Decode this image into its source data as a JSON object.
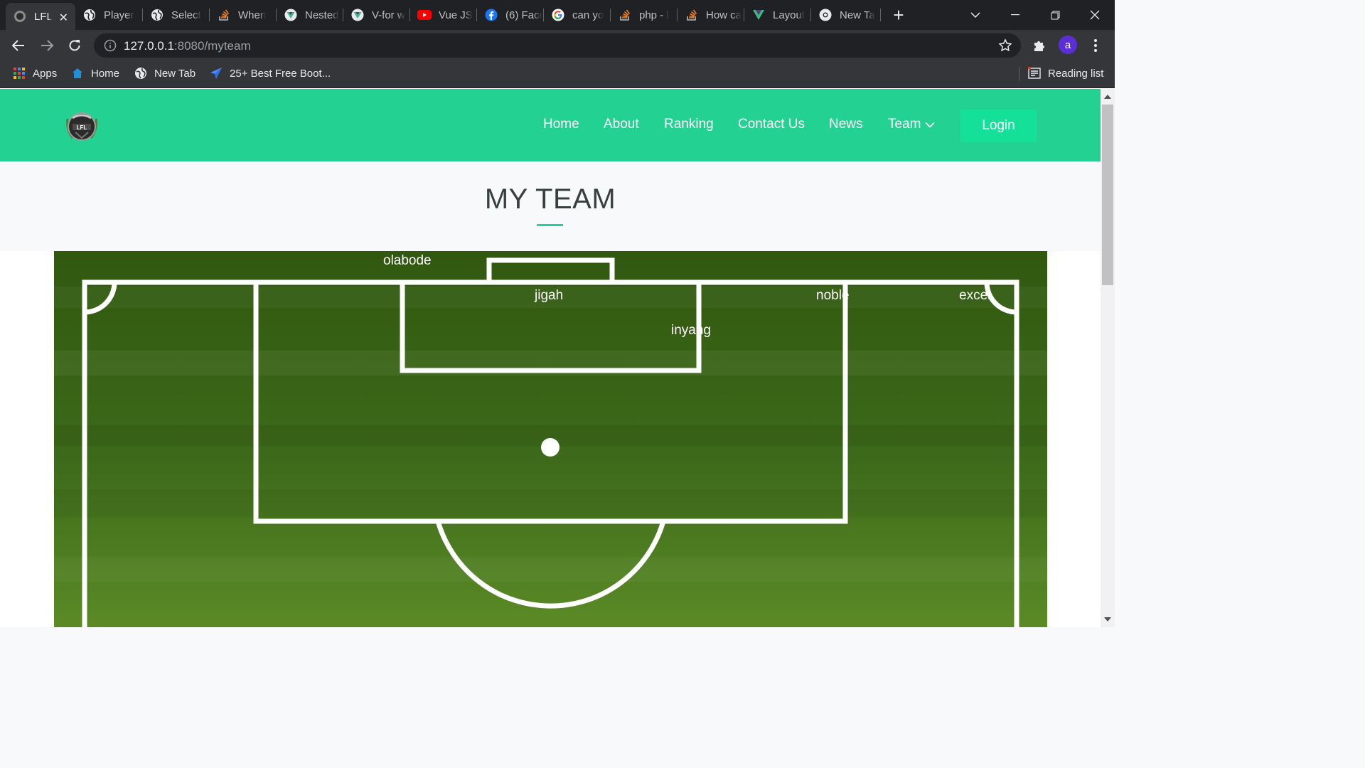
{
  "browser": {
    "tabs": [
      {
        "label": "LFL",
        "icon": "lfl-logo-icon",
        "active": true
      },
      {
        "label": "Player",
        "icon": "globe-icon"
      },
      {
        "label": "Select",
        "icon": "globe-icon"
      },
      {
        "label": "When",
        "icon": "stackoverflow-icon"
      },
      {
        "label": "Nested",
        "icon": "vue-icon"
      },
      {
        "label": "V-for w",
        "icon": "vue-icon"
      },
      {
        "label": "Vue JS",
        "icon": "youtube-icon"
      },
      {
        "label": "(6) Face",
        "icon": "facebook-icon"
      },
      {
        "label": "can yo",
        "icon": "google-icon"
      },
      {
        "label": "php - l",
        "icon": "stackoverflow-icon"
      },
      {
        "label": "How ca",
        "icon": "stackoverflow-icon"
      },
      {
        "label": "Layout",
        "icon": "bootstrap-vue-icon"
      },
      {
        "label": "New Ta",
        "icon": "chrome-icon"
      }
    ],
    "address": {
      "host": "127.0.0.1",
      "path": ":8080/myteam"
    },
    "avatar_letter": "a",
    "bookmarks": [
      {
        "label": "Apps",
        "icon": "apps-grid-icon"
      },
      {
        "label": "Home",
        "icon": "home-icon"
      },
      {
        "label": "New Tab",
        "icon": "globe-icon"
      },
      {
        "label": "25+ Best Free Boot...",
        "icon": "paper-plane-icon"
      }
    ],
    "reading_list": "Reading list"
  },
  "site": {
    "nav": {
      "home": "Home",
      "about": "About",
      "ranking": "Ranking",
      "contact": "Contact Us",
      "news": "News",
      "team": "Team",
      "login": "Login"
    },
    "colors": {
      "brand": "#23d193",
      "login": "#15e09a",
      "title": "#37403f",
      "pitch": "#3f6b1c"
    },
    "page_title": "MY TEAM",
    "players": [
      "olabode",
      "jigah",
      "noble",
      "excel",
      "inyang"
    ]
  }
}
